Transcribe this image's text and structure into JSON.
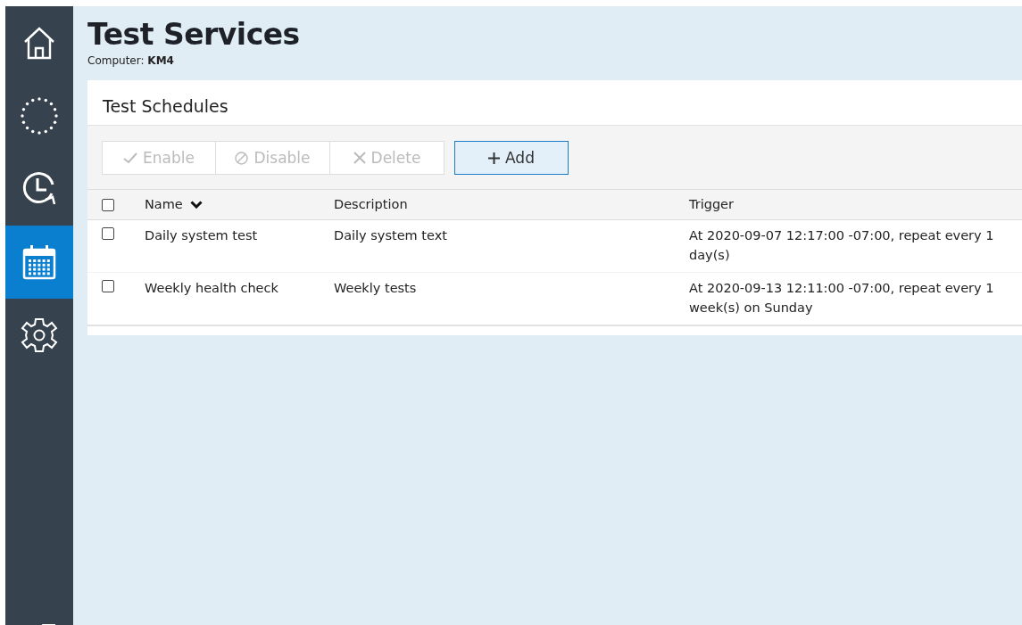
{
  "sidebar": {
    "items": [
      {
        "selected": false
      },
      {
        "selected": false
      },
      {
        "selected": false
      },
      {
        "selected": true
      },
      {
        "selected": false
      }
    ]
  },
  "header": {
    "title": "Test Services",
    "subtitle_label": "Computer:",
    "subtitle_value": "KM4"
  },
  "panel": {
    "title": "Test Schedules",
    "toolbar": [
      {
        "label": "Enable",
        "disabled": true
      },
      {
        "label": "Disable",
        "disabled": true
      },
      {
        "label": "Delete",
        "disabled": true
      },
      {
        "label": "Add",
        "disabled": false
      }
    ],
    "table": {
      "select_all_checked": false,
      "columns": [
        {
          "label": "Name",
          "sorted": true
        },
        {
          "label": "Description",
          "sorted": false
        },
        {
          "label": "Trigger",
          "sorted": false
        }
      ],
      "rows": [
        {
          "checked": false,
          "cells": [
            "Daily system test",
            "Daily system text",
            "At 2020-09-07 12:17:00 -07:00, repeat every 1 day(s)"
          ]
        },
        {
          "checked": false,
          "cells": [
            "Weekly health check",
            "Weekly tests",
            "At 2020-09-13 12:11:00 -07:00, repeat every 1 week(s) on Sunday"
          ]
        }
      ]
    }
  }
}
